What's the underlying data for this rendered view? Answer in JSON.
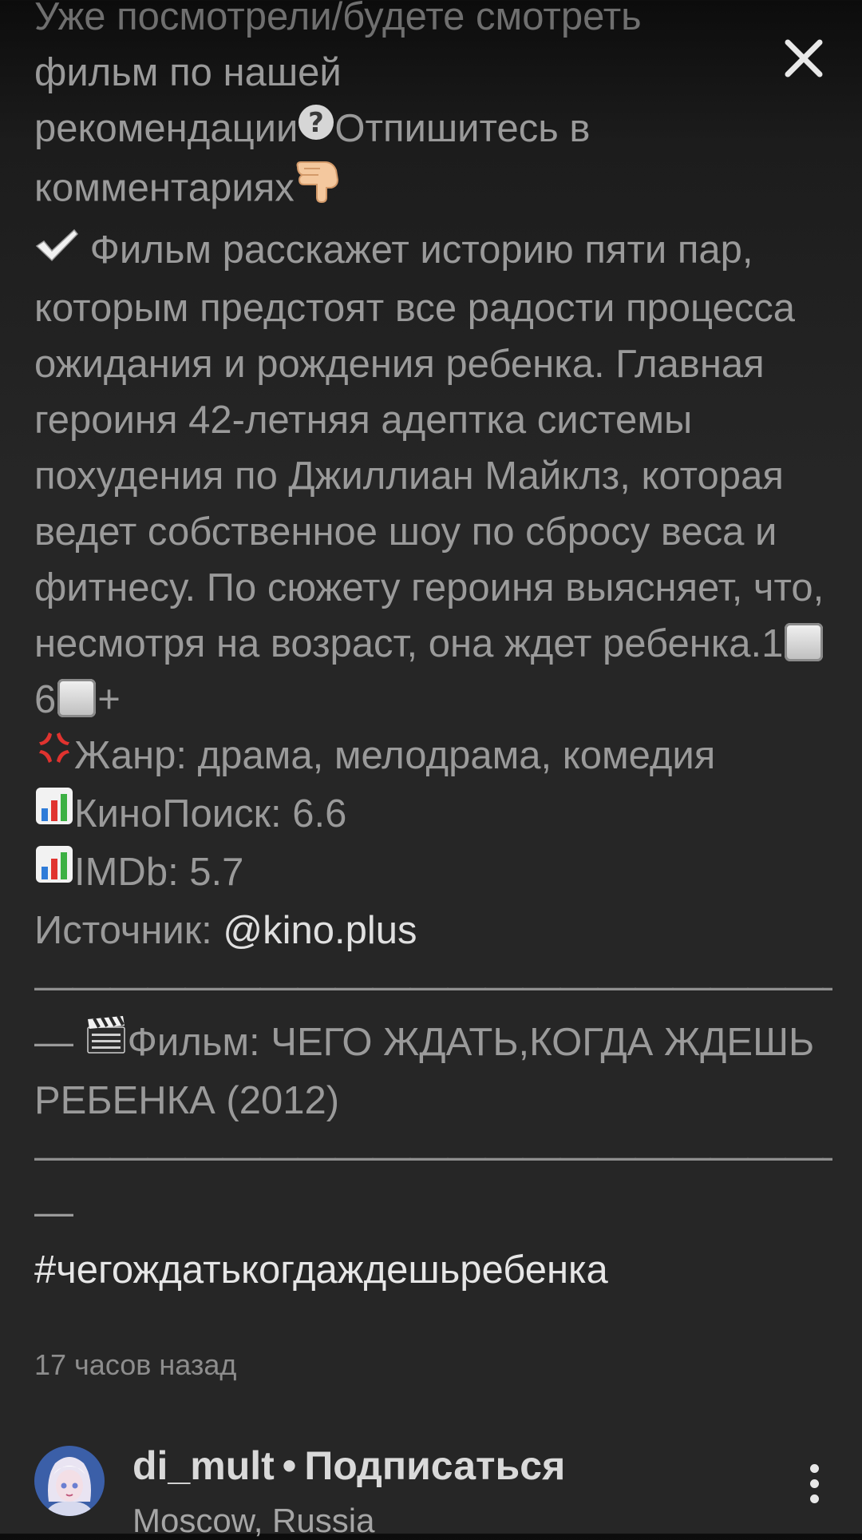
{
  "caption": {
    "line_top": "Уже посмотрели/будете смотреть",
    "line_1": "фильм по нашей",
    "line_2_a": "рекомендации",
    "line_2_b": "Отпишитесь в",
    "line_3": "комментариях",
    "description": "Фильм расскажет историю пяти пар, которым предстоят все радости процесса ожидания и рождения ребенка. Главная героиня 42-летняя адептка системы похудения по Джиллиан Майклз, которая ведет собственное шоу по сбросу веса и фитнесу. По сюжету героиня выясняет, что, несмотря на возраст, она ждет ребенка.",
    "age_digit_1": "1",
    "age_digit_2": "6",
    "age_plus": "+",
    "genre": "Жанр: драма, мелодрама, комедия",
    "kinopoisk": "КиноПоиск: 6.6",
    "imdb": "IMDb: 5.7",
    "source_label": "Источник: ",
    "source_handle": "@kino.plus",
    "divider_1": "——————————————————————",
    "divider_1_tail": "—",
    "film": "Фильм: ЧЕГО ЖДАТЬ,КОГДА ЖДЕШЬ РЕБЕНКА (2012)",
    "divider_2": "——————————————————————",
    "divider_2_tail": "—",
    "hashtag": "#чегождатькогдаждешьребенка"
  },
  "timestamp": "17 часов назад",
  "author": {
    "username": "di_mult",
    "separator": "•",
    "subscribe": "Подписаться",
    "location": "Moscow, Russia"
  },
  "icons": {
    "close": "close-icon",
    "question": "question-mark-icon",
    "pointing": "pointing-down-icon",
    "check": "check-mark-icon",
    "anger": "anger-symbol-icon",
    "chart": "bar-chart-icon",
    "clapper": "clapper-board-icon",
    "more": "more-vertical-icon"
  },
  "colors": {
    "background": "#262626",
    "text": "#9a9a9a",
    "link": "#e0e0e0",
    "close_icon": "#e8e8e8"
  }
}
